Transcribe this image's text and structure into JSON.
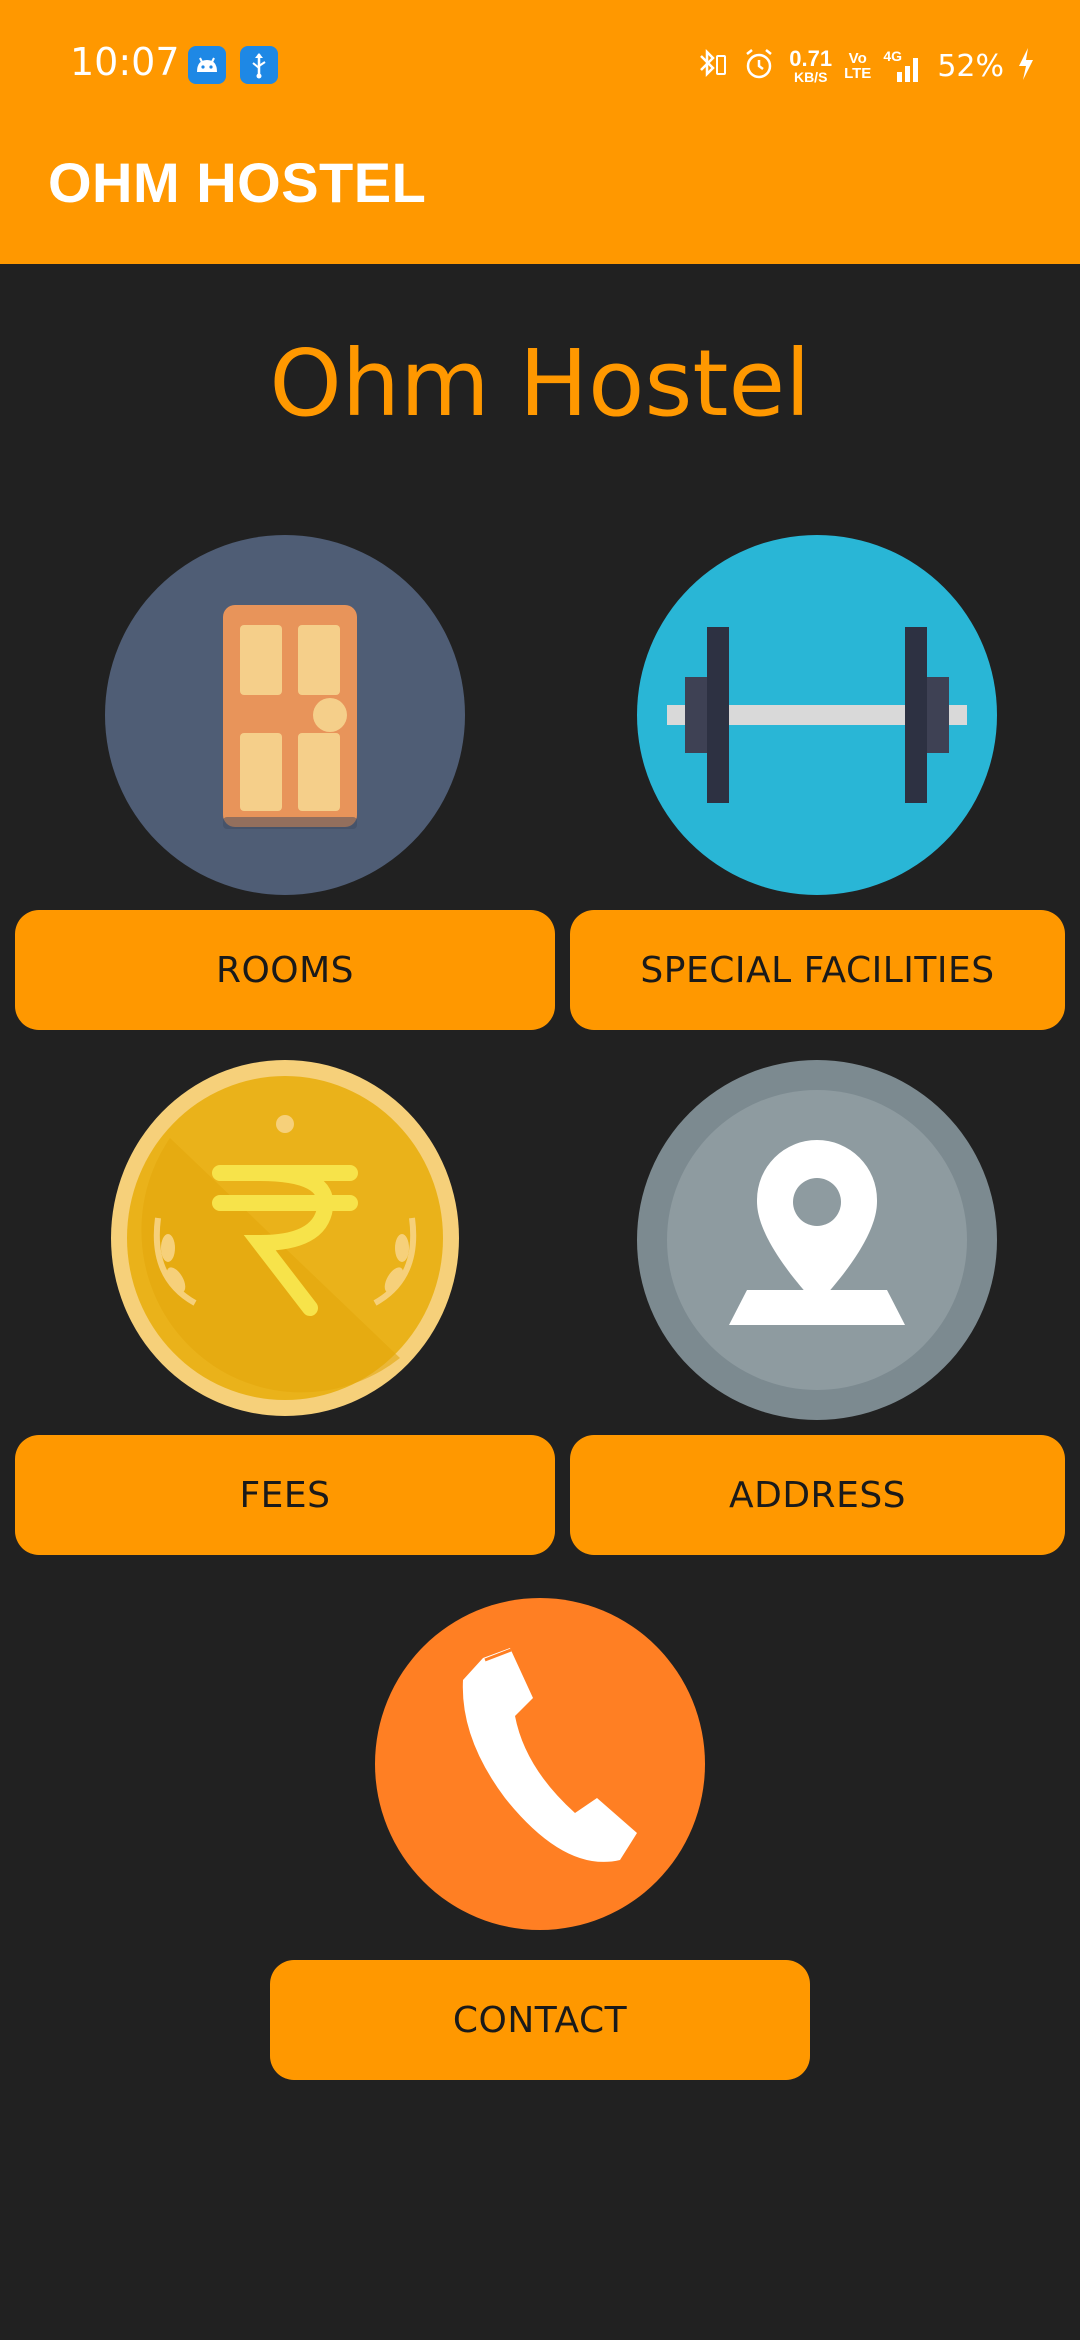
{
  "status": {
    "time": "10:07",
    "net_speed": "0.71",
    "net_speed_unit": "KB/S",
    "volte_top": "Vo",
    "volte_bottom": "LTE",
    "network_type": "4G",
    "battery": "52%"
  },
  "app": {
    "title": "OHM HOSTEL"
  },
  "main": {
    "heading": "Ohm Hostel",
    "buttons": {
      "rooms": "ROOMS",
      "facilities": "SPECIAL FACILITIES",
      "fees": "FEES",
      "address": "ADDRESS",
      "contact": "CONTACT"
    }
  },
  "colors": {
    "accent": "#FF9800",
    "background": "#212121",
    "rooms_circle": "#4F5D75",
    "facilities_circle": "#29B6D6",
    "address_circle": "#8E9BA0",
    "contact_circle": "#FF7F23"
  }
}
